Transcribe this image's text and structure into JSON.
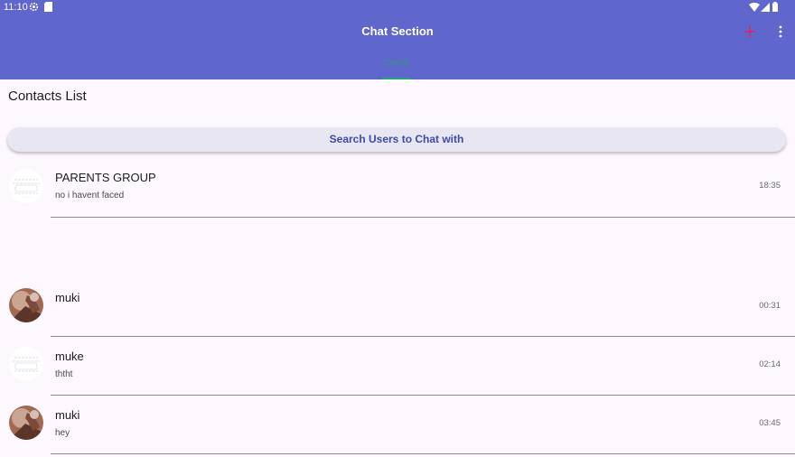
{
  "status_bar": {
    "time": "11:10",
    "icons": [
      "gear-icon",
      "sd-card-icon",
      "wifi-icon",
      "signal-icon",
      "battery-icon"
    ]
  },
  "app_bar": {
    "title": "Chat Section",
    "background": "#5f66cc",
    "actions": [
      "add-icon",
      "more-vert-icon"
    ],
    "add_icon_color": "#e0245e"
  },
  "tabs": [
    {
      "label": "CHATS",
      "selected": true,
      "indicator_color": "#22a67e"
    }
  ],
  "contacts": {
    "heading": "Contacts List",
    "search_button_label": "Search Users to Chat with"
  },
  "chats": [
    {
      "name": "PARENTS GROUP",
      "last_message": "no i havent faced",
      "time": "18:35",
      "avatar": "group-placeholder-avatar"
    },
    {
      "name": "muki",
      "last_message": "",
      "time": "00:31",
      "avatar": "photo-avatar"
    },
    {
      "name": "muke",
      "last_message": "ththt",
      "time": "02:14",
      "avatar": "group-placeholder-avatar"
    },
    {
      "name": "muki",
      "last_message": "hey",
      "time": "03:45",
      "avatar": "photo-avatar"
    }
  ]
}
